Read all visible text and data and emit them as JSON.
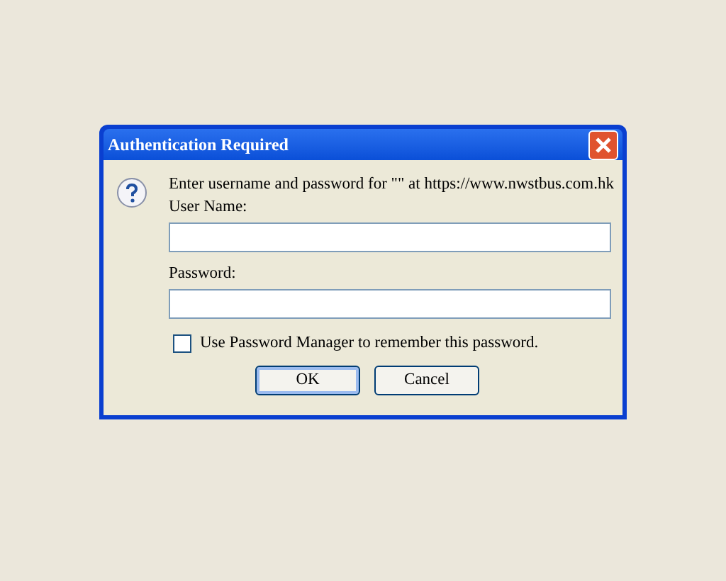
{
  "window": {
    "title": "Authentication Required"
  },
  "message": "Enter username and password for \"\" at https://www.nwstbus.com.hk",
  "fields": [
    {
      "label": "User Name:"
    },
    {
      "label": "Password:"
    }
  ],
  "checkbox": {
    "label": "Use Password Manager to remember this password.",
    "checked": false
  },
  "buttons": [
    {
      "label": "OK",
      "selected": true
    },
    {
      "label": "Cancel",
      "selected": false
    }
  ]
}
